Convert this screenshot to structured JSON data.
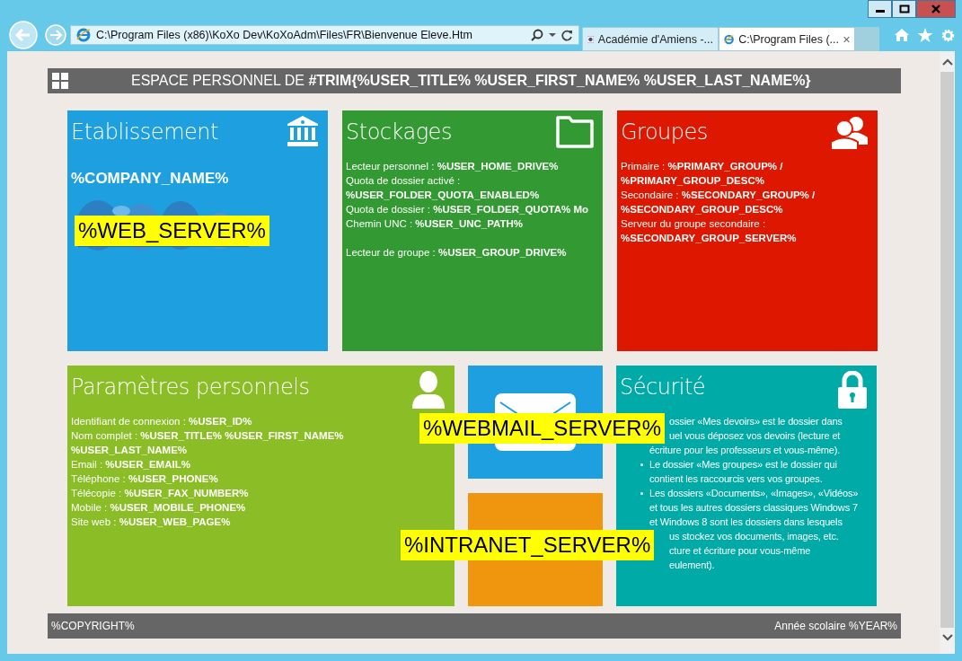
{
  "browser": {
    "address": "C:\\Program Files (x86)\\KoXo Dev\\KoXoAdm\\Files\\FR\\Bienvenue Eleve.Htm",
    "tabs": [
      {
        "title": "Académie d'Amiens -...",
        "selected": false
      },
      {
        "title": "C:\\Program Files (...",
        "selected": true
      }
    ]
  },
  "header": {
    "title": "ESPACE PERSONNEL DE **#TRIM{%USER_TITLE% %USER_FIRST_NAME% %USER_LAST_NAME%}**"
  },
  "etablissement": {
    "title": "Etablissement",
    "company": "%COMPANY_NAME%",
    "server": "%WEB_SERVER%"
  },
  "stockages": {
    "title": "Stockages",
    "groups": [
      [
        "Lecteur personnel : **%USER_HOME_DRIVE%**",
        "Quota de dossier activé : **%USER_FOLDER_QUOTA_ENABLED%**",
        "Quota de dossier : **%USER_FOLDER_QUOTA% Mo**",
        "Chemin UNC : **%USER_UNC_PATH%**"
      ],
      [
        "Lecteur de groupe : **%USER_GROUP_DRIVE%**"
      ]
    ]
  },
  "groupes": {
    "title": "Groupes",
    "lines": [
      "Primaire : **%PRIMARY_GROUP% / %PRIMARY_GROUP_DESC%**",
      "Secondaire : **%SECONDARY_GROUP% / %SECONDARY_GROUP_DESC%**",
      "Serveur du groupe secondaire : **%SECONDARY_GROUP_SERVER%**"
    ]
  },
  "parametres": {
    "title": "Paramètres personnels",
    "lines": [
      "Identifiant de connexion : **%USER_ID%**",
      "Nom complet : **%USER_TITLE% %USER_FIRST_NAME% %USER_LAST_NAME%**",
      "Email : **%USER_EMAIL%**",
      "Téléphone : **%USER_PHONE%**",
      "Télécopie : **%USER_FAX_NUMBER%**",
      "Mobile : **%USER_MOBILE_PHONE%**",
      "Site web : **%USER_WEB_PAGE%**"
    ]
  },
  "webmail": {
    "server": "%WEBMAIL_SERVER%"
  },
  "intranet": {
    "server": "%INTRANET_SERVER%"
  },
  "securite": {
    "title": "Sécurité",
    "bullets": [
      {
        "marker": false,
        "lines": [
          {
            "text": "ossier «Mes devoirs» est le dossier dans",
            "covered": true
          },
          {
            "text": "uel vous déposez vos devoirs (lecture et",
            "covered": true
          },
          {
            "text": "écriture pour les professeurs et vous-même).",
            "covered": false
          }
        ]
      },
      {
        "marker": true,
        "lines": [
          {
            "text": "Le dossier «Mes groupes» est le dossier qui",
            "covered": false
          },
          {
            "text": "contient les raccourcis vers vos groupes.",
            "covered": false
          }
        ]
      },
      {
        "marker": true,
        "lines": [
          {
            "text": "Les dossiers «Documents», «Images», «Vidéos»",
            "covered": false
          },
          {
            "text": "et tous les autres dossiers classiques Windows 7",
            "covered": false
          },
          {
            "text": "et Windows 8 sont les dossiers dans lesquels",
            "covered": false
          },
          {
            "text": "us stockez vos documents, images, etc.",
            "covered": true
          },
          {
            "text": "cture et écriture pour vous-même",
            "covered": true
          },
          {
            "text": "eulement).",
            "covered": true
          }
        ]
      }
    ]
  },
  "footer": {
    "left": "%COPYRIGHT%",
    "right": "Année scolaire %YEAR%"
  }
}
